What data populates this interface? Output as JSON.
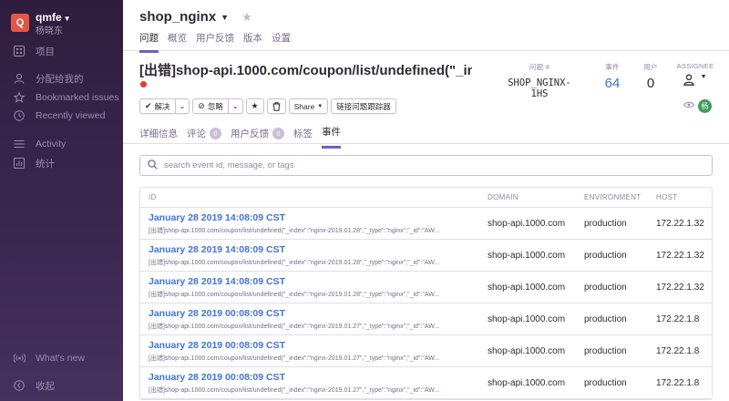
{
  "org": {
    "avatar": "Q",
    "name": "qmfe",
    "user": "杨晓东"
  },
  "sidebar": {
    "items": [
      {
        "label": "项目",
        "icon": "grid-icon"
      },
      {
        "label": "分配给我的",
        "icon": "user-icon"
      },
      {
        "label": "Bookmarked issues",
        "icon": "star-icon"
      },
      {
        "label": "Recently viewed",
        "icon": "clock-icon"
      },
      {
        "label": "Activity",
        "icon": "list-icon"
      },
      {
        "label": "统计",
        "icon": "bar-chart-icon"
      }
    ],
    "footer": [
      {
        "label": "What's new",
        "icon": "broadcast-icon"
      },
      {
        "label": "收起",
        "icon": "collapse-icon"
      }
    ]
  },
  "header": {
    "project": "shop_nginx",
    "tabs": [
      "问题",
      "概览",
      "用户反馈",
      "版本",
      "设置"
    ],
    "active_tab": 0
  },
  "issue": {
    "title": "[出错]shop-api.1000.com/coupon/list/undefined(\"_in...",
    "status_color": "#e03e2f",
    "id_label": "问题 #",
    "id_value": "SHOP_NGINX-1HS",
    "events_label": "事件",
    "events_value": "64",
    "users_label": "用户",
    "users_value": "0",
    "assignee_label": "ASSIGNEE",
    "assignee_avatar": "杨"
  },
  "actions": {
    "resolve": "解决",
    "ignore": "忽略",
    "share": "Share",
    "link": "链接问题跟踪器"
  },
  "issue_tabs": [
    {
      "label": "详细信息",
      "badge": ""
    },
    {
      "label": "评论",
      "badge": "0"
    },
    {
      "label": "用户反馈",
      "badge": "0"
    },
    {
      "label": "标签",
      "badge": ""
    },
    {
      "label": "事件",
      "badge": ""
    }
  ],
  "search": {
    "placeholder": "search event id, message, or tags"
  },
  "table": {
    "headers": [
      "ID",
      "DOMAIN",
      "ENVIRONMENT",
      "HOST"
    ],
    "rows": [
      {
        "time": "January 28 2019 14:08:09 CST",
        "msg": "[出错]shop-api.1000.com/coupon/list/undefined(\"_index\":\"nginx-2019.01.28\",\"_type\":\"nginx\",\"_id\":\"AW...",
        "domain": "shop-api.1000.com",
        "env": "production",
        "host": "172.22.1.32"
      },
      {
        "time": "January 28 2019 14:08:09 CST",
        "msg": "[出错]shop-api.1000.com/coupon/list/undefined(\"_index\":\"nginx-2019.01.28\",\"_type\":\"nginx\",\"_id\":\"AW...",
        "domain": "shop-api.1000.com",
        "env": "production",
        "host": "172.22.1.32"
      },
      {
        "time": "January 28 2019 14:08:09 CST",
        "msg": "[出错]shop-api.1000.com/coupon/list/undefined(\"_index\":\"nginx-2019.01.28\",\"_type\":\"nginx\",\"_id\":\"AW...",
        "domain": "shop-api.1000.com",
        "env": "production",
        "host": "172.22.1.32"
      },
      {
        "time": "January 28 2019 00:08:09 CST",
        "msg": "[出错]shop-api.1000.com/coupon/list/undefined(\"_index\":\"nginx-2019.01.27\",\"_type\":\"nginx\",\"_id\":\"AW...",
        "domain": "shop-api.1000.com",
        "env": "production",
        "host": "172.22.1.8"
      },
      {
        "time": "January 28 2019 00:08:09 CST",
        "msg": "[出错]shop-api.1000.com/coupon/list/undefined(\"_index\":\"nginx-2019.01.27\",\"_type\":\"nginx\",\"_id\":\"AW...",
        "domain": "shop-api.1000.com",
        "env": "production",
        "host": "172.22.1.8"
      },
      {
        "time": "January 28 2019 00:08:09 CST",
        "msg": "[出错]shop-api.1000.com/coupon/list/undefined(\"_index\":\"nginx-2019.01.27\",\"_type\":\"nginx\",\"_id\":\"AW...",
        "domain": "shop-api.1000.com",
        "env": "production",
        "host": "172.22.1.8"
      }
    ]
  }
}
